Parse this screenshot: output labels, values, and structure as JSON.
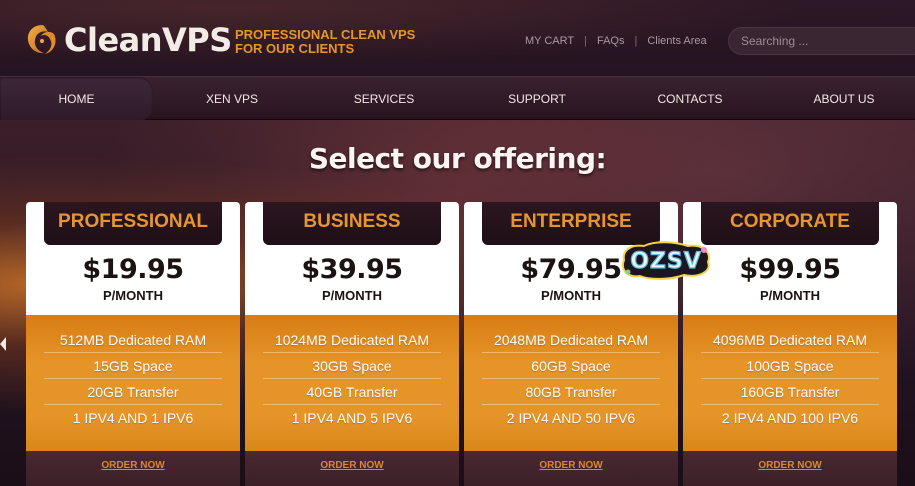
{
  "brand": {
    "name": "CleanVPS",
    "tagline": "PROFESSIONAL CLEAN VPS FOR OUR CLIENTS"
  },
  "toplinks": [
    "MY CART",
    "FAQs",
    "Clients Area"
  ],
  "search": {
    "placeholder": "Searching ..."
  },
  "nav": [
    "HOME",
    "XEN VPS",
    "SERVICES",
    "SUPPORT",
    "CONTACTS",
    "ABOUT US"
  ],
  "hero": {
    "title": "Select our offering:"
  },
  "plans": [
    {
      "name": "PROFESSIONAL",
      "price": "$19.95",
      "period": "P/MONTH",
      "features": [
        "512MB Dedicated RAM",
        "15GB Space",
        "20GB Transfer",
        "1 IPV4 AND 1 IPV6"
      ],
      "cta": "ORDER NOW"
    },
    {
      "name": "BUSINESS",
      "price": "$39.95",
      "period": "P/MONTH",
      "features": [
        "1024MB Dedicated RAM",
        "30GB Space",
        "40GB Transfer",
        "1 IPV4 AND 5 IPV6"
      ],
      "cta": "ORDER NOW"
    },
    {
      "name": "ENTERPRISE",
      "price": "$79.95",
      "period": "P/MONTH",
      "features": [
        "2048MB Dedicated RAM",
        "60GB Space",
        "80GB Transfer",
        "2 IPV4 AND 50 IPV6"
      ],
      "cta": "ORDER NOW"
    },
    {
      "name": "CORPORATE",
      "price": "$99.95",
      "period": "P/MONTH",
      "features": [
        "4096MB Dedicated RAM",
        "100GB Space",
        "160GB Transfer",
        "2 IPV4 AND 100 IPV6"
      ],
      "cta": "ORDER NOW"
    }
  ],
  "sticker": {
    "text": "OZSV"
  },
  "colors": {
    "accent": "#e59428",
    "tab_text": "#e89530",
    "dark": "#1f0f17"
  }
}
